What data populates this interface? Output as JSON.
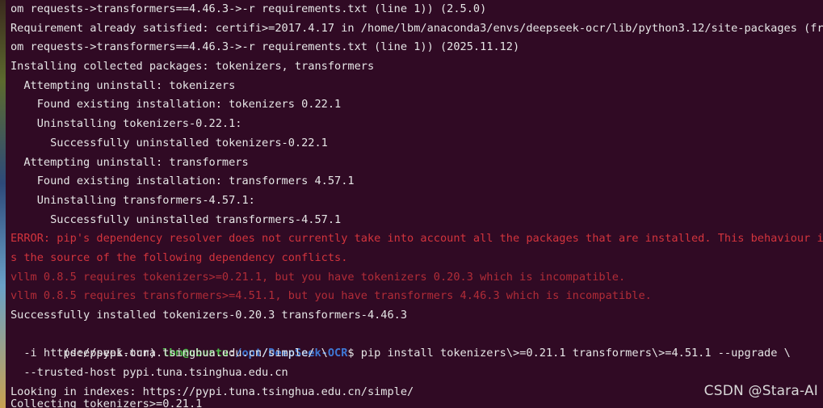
{
  "terminal": {
    "lines": [
      {
        "text": "om requests->transformers==4.46.3->-r requirements.txt (line 1)) (2.5.0)",
        "kind": "normal"
      },
      {
        "text": "Requirement already satisfied: certifi>=2017.4.17 in /home/lbm/anaconda3/envs/deepseek-ocr/lib/python3.12/site-packages (fr",
        "kind": "normal"
      },
      {
        "text": "om requests->transformers==4.46.3->-r requirements.txt (line 1)) (2025.11.12)",
        "kind": "normal"
      },
      {
        "text": "Installing collected packages: tokenizers, transformers",
        "kind": "normal"
      },
      {
        "text": "  Attempting uninstall: tokenizers",
        "kind": "normal"
      },
      {
        "text": "    Found existing installation: tokenizers 0.22.1",
        "kind": "normal"
      },
      {
        "text": "    Uninstalling tokenizers-0.22.1:",
        "kind": "normal"
      },
      {
        "text": "      Successfully uninstalled tokenizers-0.22.1",
        "kind": "normal"
      },
      {
        "text": "  Attempting uninstall: transformers",
        "kind": "normal"
      },
      {
        "text": "    Found existing installation: transformers 4.57.1",
        "kind": "normal"
      },
      {
        "text": "    Uninstalling transformers-4.57.1:",
        "kind": "normal"
      },
      {
        "text": "      Successfully uninstalled transformers-4.57.1",
        "kind": "normal"
      },
      {
        "text": "ERROR: pip's dependency resolver does not currently take into account all the packages that are installed. This behaviour i",
        "kind": "error"
      },
      {
        "text": "s the source of the following dependency conflicts.",
        "kind": "error"
      },
      {
        "text": "vllm 0.8.5 requires tokenizers>=0.21.1, but you have tokenizers 0.20.3 which is incompatible.",
        "kind": "error"
      },
      {
        "text": "vllm 0.8.5 requires transformers>=4.51.1, but you have transformers 4.46.3 which is incompatible.",
        "kind": "error"
      },
      {
        "text": "Successfully installed tokenizers-0.20.3 transformers-4.46.3",
        "kind": "normal"
      }
    ],
    "prompt": {
      "env": "(deepseek-ocr) ",
      "user_host": "lbm@ubuntu",
      "colon": ":",
      "path": "/opt/DeepSeek-OCR",
      "dollar": "$ ",
      "command": "pip install tokenizers\\>=0.21.1 transformers\\>=4.51.1 --upgrade \\"
    },
    "after_prompt": [
      "  -i https://pypi.tuna.tsinghua.edu.cn/simple/ \\",
      "  --trusted-host pypi.tuna.tsinghua.edu.cn",
      "Looking in indexes: https://pypi.tuna.tsinghua.edu.cn/simple/"
    ],
    "partial_last_line": "Collecting tokenizers>=0.21.1"
  },
  "watermark": "CSDN @Stara-AI",
  "colors": {
    "background": "#300a24",
    "text": "#e6e6e6",
    "error": "#d3343d",
    "prompt_user": "#4ec04a",
    "prompt_path": "#3f78d6"
  }
}
